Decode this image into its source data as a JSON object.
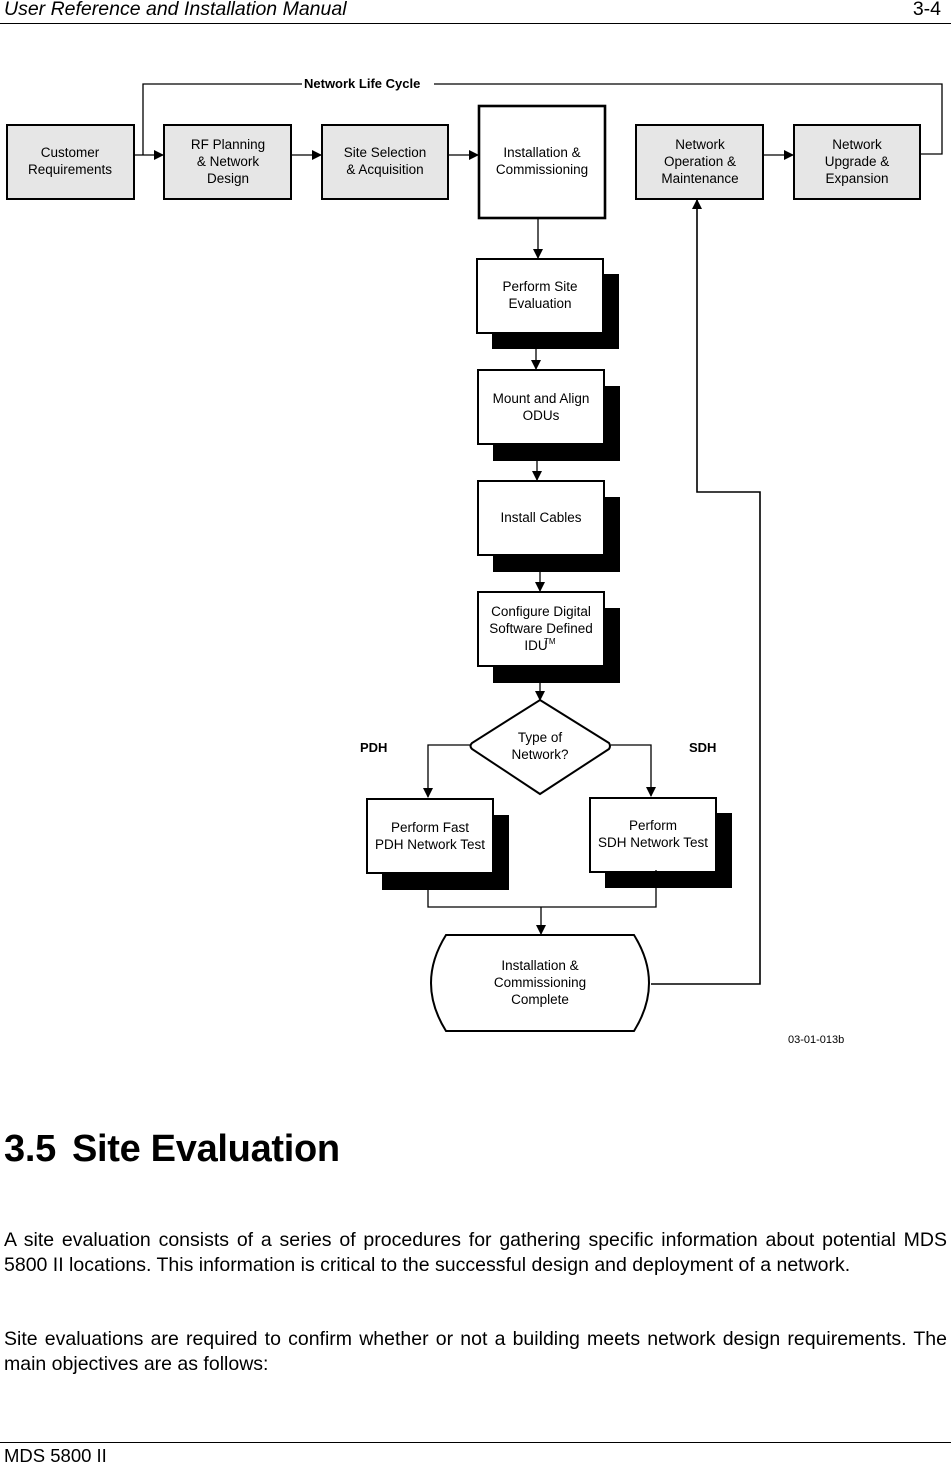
{
  "header": {
    "title": "User Reference and Installation Manual",
    "page": "3-4"
  },
  "diagram": {
    "life_cycle_label": "Network Life Cycle",
    "top_row": [
      {
        "lines": [
          "Customer",
          "Requirements"
        ]
      },
      {
        "lines": [
          "RF Planning",
          "& Network",
          "Design"
        ]
      },
      {
        "lines": [
          "Site Selection",
          "& Acquisition"
        ]
      },
      {
        "lines": [
          "Installation &",
          "Commissioning"
        ]
      },
      {
        "lines": [
          "Network",
          "Operation &",
          "Maintenance"
        ]
      },
      {
        "lines": [
          "Network",
          "Upgrade &",
          "Expansion"
        ]
      }
    ],
    "steps": [
      {
        "lines": [
          "Perform Site",
          "Evaluation"
        ]
      },
      {
        "lines": [
          "Mount and Align",
          "ODUs"
        ]
      },
      {
        "lines": [
          "Install Cables"
        ]
      },
      {
        "lines": [
          "Configure Digital",
          "Software Defined",
          "IDU"
        ],
        "superscript": "TM"
      }
    ],
    "decision": {
      "lines": [
        "Type of",
        "Network?"
      ]
    },
    "branch_left_label": "PDH",
    "branch_right_label": "SDH",
    "pdh_test": {
      "lines": [
        "Perform Fast",
        "PDH Network Test"
      ]
    },
    "sdh_test": {
      "lines": [
        "Perform",
        "SDH Network Test"
      ]
    },
    "terminal": {
      "lines": [
        "Installation &",
        "Commissioning",
        "Complete"
      ]
    },
    "figure_id": "03-01-013b",
    "colors": {
      "top_box_fill": "#e6e6e6",
      "stroke": "#000000",
      "shadow": "#000000"
    }
  },
  "section": {
    "number": "3.5",
    "title": "Site Evaluation",
    "paragraphs": [
      "A site evaluation consists of a series of procedures for gathering specific information about potential MDS 5800 II locations.  This information is critical to the successful design and deployment of a network.",
      "Site evaluations are required to confirm whether or not a building meets network design requirements.  The main objectives are as follows:"
    ]
  },
  "footer": {
    "product": "MDS 5800 II"
  }
}
